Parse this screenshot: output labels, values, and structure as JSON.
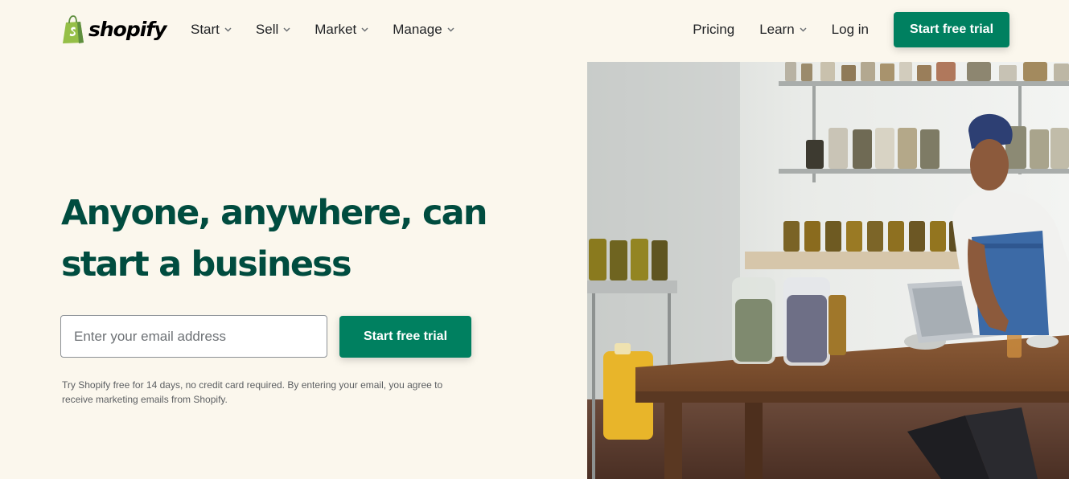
{
  "brand": {
    "name": "shopify",
    "color": "#008060",
    "bag_color": "#95bf47",
    "headline_color": "#004c3f",
    "background": "#fbf7ed"
  },
  "nav": {
    "left": [
      {
        "label": "Start",
        "icon": "chevron-down-icon"
      },
      {
        "label": "Sell",
        "icon": "chevron-down-icon"
      },
      {
        "label": "Market",
        "icon": "chevron-down-icon"
      },
      {
        "label": "Manage",
        "icon": "chevron-down-icon"
      }
    ],
    "right": {
      "pricing": "Pricing",
      "learn": "Learn",
      "login": "Log in",
      "cta": "Start free trial"
    }
  },
  "hero": {
    "headline_line1": "Anyone, anywhere, can",
    "headline_line2": "start a business",
    "email_placeholder": "Enter your email address",
    "email_value": "",
    "cta": "Start free trial",
    "disclaimer": "Try Shopify free for 14 days, no credit card required. By entering your email, you agree to receive marketing emails from Shopify."
  }
}
